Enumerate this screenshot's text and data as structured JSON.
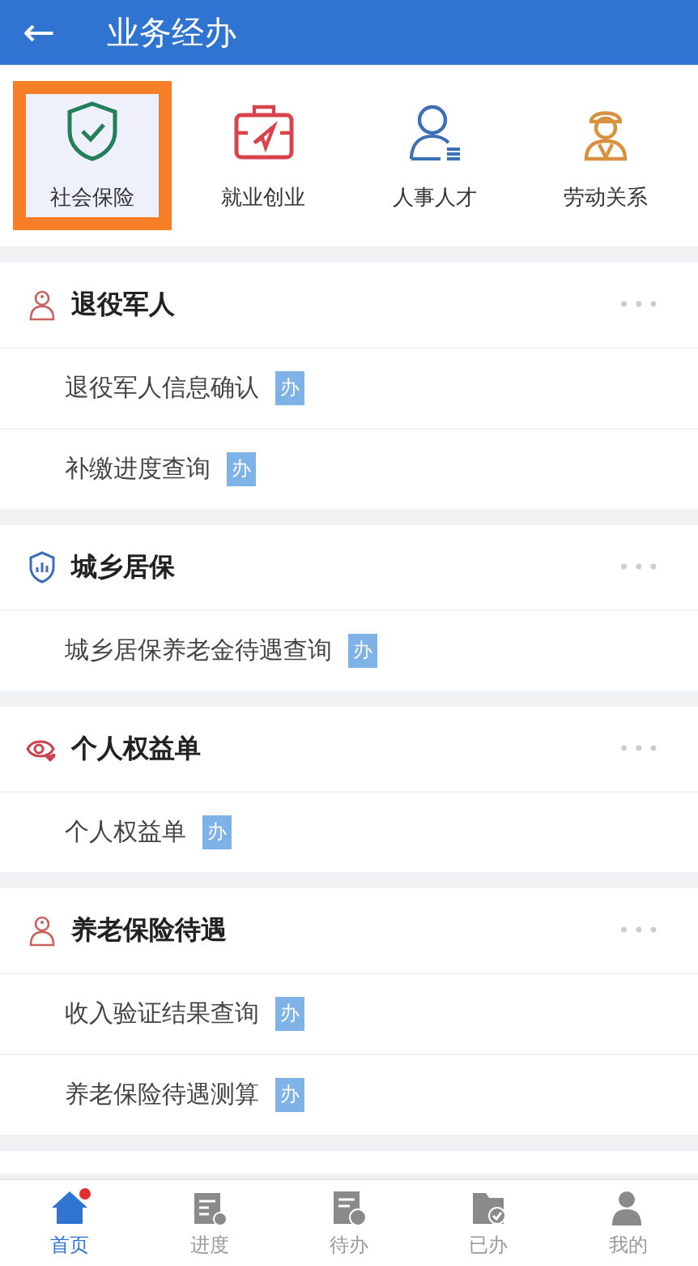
{
  "header": {
    "back": "←",
    "title": "业务经办"
  },
  "categories": [
    {
      "label": "社会保险",
      "kind": "shield",
      "selected": true
    },
    {
      "label": "就业创业",
      "kind": "briefcase",
      "selected": false
    },
    {
      "label": "人事人才",
      "kind": "person",
      "selected": false
    },
    {
      "label": "劳动关系",
      "kind": "worker",
      "selected": false
    }
  ],
  "sections": [
    {
      "title": "退役军人",
      "kind": "veteran",
      "more": "•••",
      "items": [
        {
          "label": "退役军人信息确认",
          "badge": "办"
        },
        {
          "label": "补缴进度查询",
          "badge": "办"
        }
      ]
    },
    {
      "title": "城乡居保",
      "kind": "chart",
      "more": "•••",
      "items": [
        {
          "label": "城乡居保养老金待遇查询",
          "badge": "办"
        }
      ]
    },
    {
      "title": "个人权益单",
      "kind": "eye",
      "more": "•••",
      "items": [
        {
          "label": "个人权益单",
          "badge": "办"
        }
      ]
    },
    {
      "title": "养老保险待遇",
      "kind": "veteran",
      "more": "•••",
      "items": [
        {
          "label": "收入验证结果查询",
          "badge": "办"
        },
        {
          "label": "养老保险待遇测算",
          "badge": "办"
        }
      ]
    }
  ],
  "tabbar": [
    {
      "label": "首页",
      "kind": "home",
      "selected": true,
      "dot": true
    },
    {
      "label": "进度",
      "kind": "calendar",
      "selected": false,
      "dot": false
    },
    {
      "label": "待办",
      "kind": "todo",
      "selected": false,
      "dot": false
    },
    {
      "label": "已办",
      "kind": "done",
      "selected": false,
      "dot": false
    },
    {
      "label": "我的",
      "kind": "me",
      "selected": false,
      "dot": false
    }
  ]
}
